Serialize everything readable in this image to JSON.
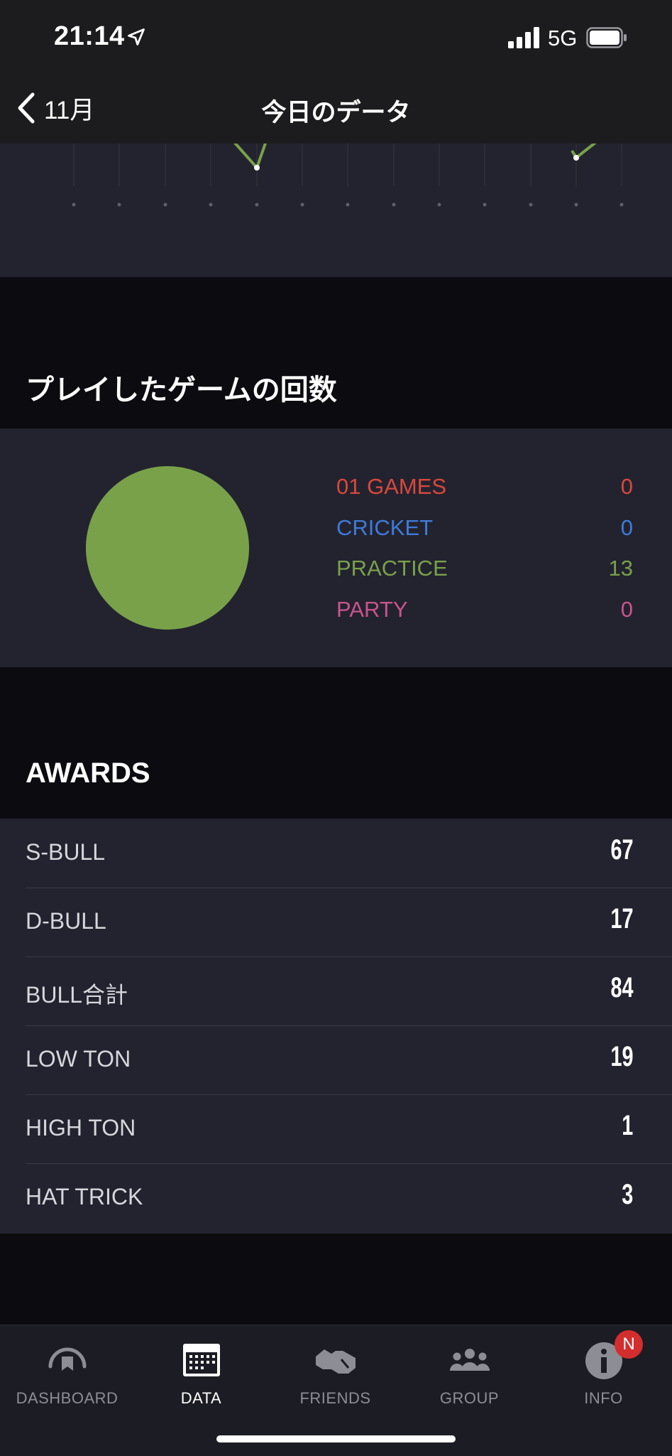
{
  "status_bar": {
    "time": "21:14",
    "network": "5G"
  },
  "nav": {
    "back_label": "11月",
    "title": "今日のデータ"
  },
  "games_section": {
    "title": "プレイしたゲームの回数",
    "legend": [
      {
        "label": "01 GAMES",
        "value": "0",
        "color": "#d9483d"
      },
      {
        "label": "CRICKET",
        "value": "0",
        "color": "#3f7ad9"
      },
      {
        "label": "PRACTICE",
        "value": "13",
        "color": "#79a14a"
      },
      {
        "label": "PARTY",
        "value": "0",
        "color": "#c9548f"
      }
    ],
    "pie_color": "#79a14a"
  },
  "awards_section": {
    "title": "AWARDS",
    "items": [
      {
        "label": "S-BULL",
        "value": "67"
      },
      {
        "label": "D-BULL",
        "value": "17"
      },
      {
        "label": "BULL合計",
        "value": "84"
      },
      {
        "label": "LOW TON",
        "value": "19"
      },
      {
        "label": "HIGH TON",
        "value": "1"
      },
      {
        "label": "HAT TRICK",
        "value": "3"
      }
    ]
  },
  "tab_bar": {
    "tabs": [
      {
        "label": "DASHBOARD",
        "icon": "dashboard-icon"
      },
      {
        "label": "DATA",
        "icon": "calendar-icon"
      },
      {
        "label": "FRIENDS",
        "icon": "handshake-icon"
      },
      {
        "label": "GROUP",
        "icon": "group-icon"
      },
      {
        "label": "INFO",
        "icon": "info-icon"
      }
    ],
    "active": "DATA",
    "badge": "N"
  }
}
